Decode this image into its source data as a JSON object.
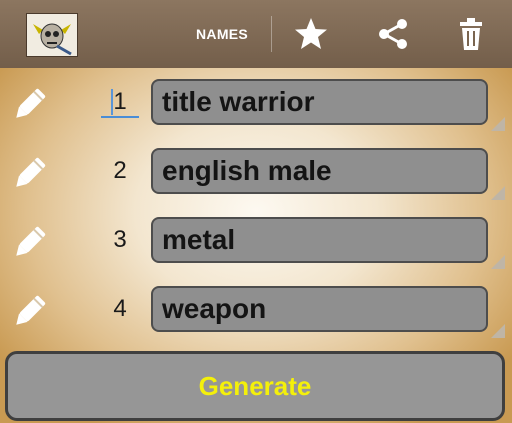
{
  "action_bar": {
    "title": "NAMES",
    "app_icon": "skull-warrior-icon",
    "actions": [
      "star-icon",
      "share-icon",
      "trash-icon"
    ]
  },
  "rows": [
    {
      "number": "1",
      "value": "title warrior"
    },
    {
      "number": "2",
      "value": "english male"
    },
    {
      "number": "3",
      "value": "metal"
    },
    {
      "number": "4",
      "value": "weapon"
    }
  ],
  "generate_label": "Generate",
  "colors": {
    "action_bar": "#7f6a55",
    "field_bg": "#8f8f8f",
    "generate_text": "#f4f00a",
    "focus_accent": "#4a8dd6"
  }
}
